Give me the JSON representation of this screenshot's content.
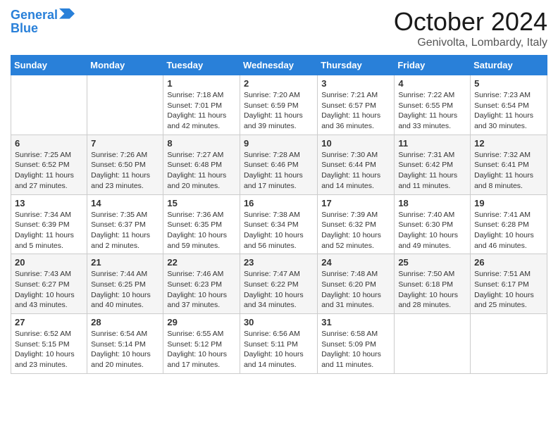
{
  "header": {
    "logo_line1": "General",
    "logo_line2": "Blue",
    "month": "October 2024",
    "location": "Genivolta, Lombardy, Italy"
  },
  "days_of_week": [
    "Sunday",
    "Monday",
    "Tuesday",
    "Wednesday",
    "Thursday",
    "Friday",
    "Saturday"
  ],
  "weeks": [
    [
      {
        "num": "",
        "info": ""
      },
      {
        "num": "",
        "info": ""
      },
      {
        "num": "1",
        "info": "Sunrise: 7:18 AM\nSunset: 7:01 PM\nDaylight: 11 hours and 42 minutes."
      },
      {
        "num": "2",
        "info": "Sunrise: 7:20 AM\nSunset: 6:59 PM\nDaylight: 11 hours and 39 minutes."
      },
      {
        "num": "3",
        "info": "Sunrise: 7:21 AM\nSunset: 6:57 PM\nDaylight: 11 hours and 36 minutes."
      },
      {
        "num": "4",
        "info": "Sunrise: 7:22 AM\nSunset: 6:55 PM\nDaylight: 11 hours and 33 minutes."
      },
      {
        "num": "5",
        "info": "Sunrise: 7:23 AM\nSunset: 6:54 PM\nDaylight: 11 hours and 30 minutes."
      }
    ],
    [
      {
        "num": "6",
        "info": "Sunrise: 7:25 AM\nSunset: 6:52 PM\nDaylight: 11 hours and 27 minutes."
      },
      {
        "num": "7",
        "info": "Sunrise: 7:26 AM\nSunset: 6:50 PM\nDaylight: 11 hours and 23 minutes."
      },
      {
        "num": "8",
        "info": "Sunrise: 7:27 AM\nSunset: 6:48 PM\nDaylight: 11 hours and 20 minutes."
      },
      {
        "num": "9",
        "info": "Sunrise: 7:28 AM\nSunset: 6:46 PM\nDaylight: 11 hours and 17 minutes."
      },
      {
        "num": "10",
        "info": "Sunrise: 7:30 AM\nSunset: 6:44 PM\nDaylight: 11 hours and 14 minutes."
      },
      {
        "num": "11",
        "info": "Sunrise: 7:31 AM\nSunset: 6:42 PM\nDaylight: 11 hours and 11 minutes."
      },
      {
        "num": "12",
        "info": "Sunrise: 7:32 AM\nSunset: 6:41 PM\nDaylight: 11 hours and 8 minutes."
      }
    ],
    [
      {
        "num": "13",
        "info": "Sunrise: 7:34 AM\nSunset: 6:39 PM\nDaylight: 11 hours and 5 minutes."
      },
      {
        "num": "14",
        "info": "Sunrise: 7:35 AM\nSunset: 6:37 PM\nDaylight: 11 hours and 2 minutes."
      },
      {
        "num": "15",
        "info": "Sunrise: 7:36 AM\nSunset: 6:35 PM\nDaylight: 10 hours and 59 minutes."
      },
      {
        "num": "16",
        "info": "Sunrise: 7:38 AM\nSunset: 6:34 PM\nDaylight: 10 hours and 56 minutes."
      },
      {
        "num": "17",
        "info": "Sunrise: 7:39 AM\nSunset: 6:32 PM\nDaylight: 10 hours and 52 minutes."
      },
      {
        "num": "18",
        "info": "Sunrise: 7:40 AM\nSunset: 6:30 PM\nDaylight: 10 hours and 49 minutes."
      },
      {
        "num": "19",
        "info": "Sunrise: 7:41 AM\nSunset: 6:28 PM\nDaylight: 10 hours and 46 minutes."
      }
    ],
    [
      {
        "num": "20",
        "info": "Sunrise: 7:43 AM\nSunset: 6:27 PM\nDaylight: 10 hours and 43 minutes."
      },
      {
        "num": "21",
        "info": "Sunrise: 7:44 AM\nSunset: 6:25 PM\nDaylight: 10 hours and 40 minutes."
      },
      {
        "num": "22",
        "info": "Sunrise: 7:46 AM\nSunset: 6:23 PM\nDaylight: 10 hours and 37 minutes."
      },
      {
        "num": "23",
        "info": "Sunrise: 7:47 AM\nSunset: 6:22 PM\nDaylight: 10 hours and 34 minutes."
      },
      {
        "num": "24",
        "info": "Sunrise: 7:48 AM\nSunset: 6:20 PM\nDaylight: 10 hours and 31 minutes."
      },
      {
        "num": "25",
        "info": "Sunrise: 7:50 AM\nSunset: 6:18 PM\nDaylight: 10 hours and 28 minutes."
      },
      {
        "num": "26",
        "info": "Sunrise: 7:51 AM\nSunset: 6:17 PM\nDaylight: 10 hours and 25 minutes."
      }
    ],
    [
      {
        "num": "27",
        "info": "Sunrise: 6:52 AM\nSunset: 5:15 PM\nDaylight: 10 hours and 23 minutes."
      },
      {
        "num": "28",
        "info": "Sunrise: 6:54 AM\nSunset: 5:14 PM\nDaylight: 10 hours and 20 minutes."
      },
      {
        "num": "29",
        "info": "Sunrise: 6:55 AM\nSunset: 5:12 PM\nDaylight: 10 hours and 17 minutes."
      },
      {
        "num": "30",
        "info": "Sunrise: 6:56 AM\nSunset: 5:11 PM\nDaylight: 10 hours and 14 minutes."
      },
      {
        "num": "31",
        "info": "Sunrise: 6:58 AM\nSunset: 5:09 PM\nDaylight: 10 hours and 11 minutes."
      },
      {
        "num": "",
        "info": ""
      },
      {
        "num": "",
        "info": ""
      }
    ]
  ]
}
